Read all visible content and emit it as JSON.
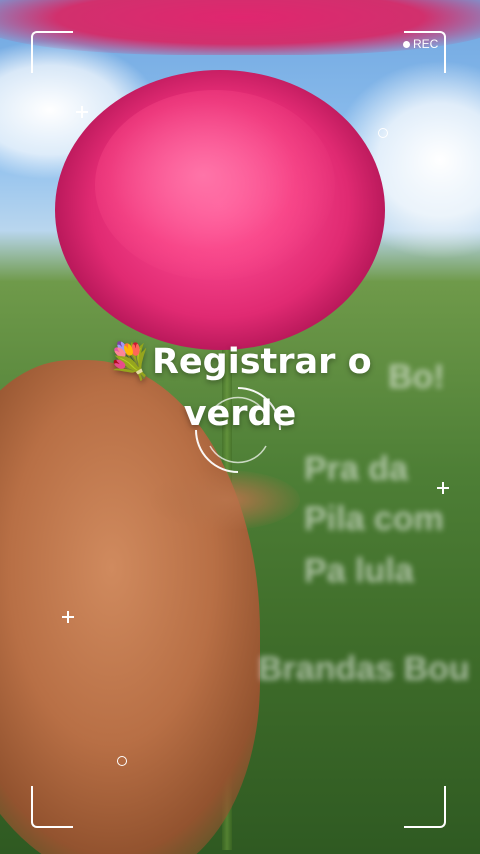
{
  "recording": {
    "label": "REC"
  },
  "caption": {
    "emoji": "💐",
    "line1": "Registrar o",
    "line2": "verde"
  },
  "colors": {
    "overlay": "#ffffff",
    "rose": "#e02a72",
    "sky": "#8fc0ee",
    "foliage": "#4e7f36"
  },
  "icons": [
    "recording-dot-icon",
    "focus-reticle-icon",
    "plus-marker-icon",
    "ring-marker-icon",
    "bouquet-icon"
  ]
}
